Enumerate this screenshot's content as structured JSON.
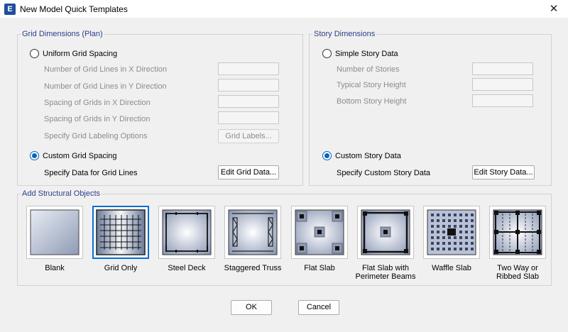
{
  "window": {
    "title": "New Model Quick Templates",
    "app_icon_letter": "E"
  },
  "grid": {
    "title": "Grid Dimensions (Plan)",
    "uniform_label": "Uniform Grid Spacing",
    "fields": [
      "Number of Grid Lines in X Direction",
      "Number of Grid Lines in Y Direction",
      "Spacing of Grids in X Direction",
      "Spacing of Grids in Y Direction"
    ],
    "labeling_label": "Specify Grid Labeling Options",
    "grid_labels_button": "Grid Labels...",
    "custom_label": "Custom Grid Spacing",
    "specify_label": "Specify Data for Grid Lines",
    "edit_button": "Edit Grid Data..."
  },
  "story": {
    "title": "Story Dimensions",
    "simple_label": "Simple Story Data",
    "fields": [
      "Number of Stories",
      "Typical Story Height",
      "Bottom Story Height"
    ],
    "custom_label": "Custom Story Data",
    "specify_label": "Specify Custom Story Data",
    "edit_button": "Edit Story Data..."
  },
  "objects": {
    "title": "Add Structural Objects",
    "selected": "Grid Only",
    "items": [
      {
        "label1": "Blank",
        "label2": ""
      },
      {
        "label1": "Grid Only",
        "label2": ""
      },
      {
        "label1": "Steel Deck",
        "label2": ""
      },
      {
        "label1": "Staggered Truss",
        "label2": ""
      },
      {
        "label1": "Flat Slab",
        "label2": ""
      },
      {
        "label1": "Flat Slab with",
        "label2": "Perimeter Beams"
      },
      {
        "label1": "Waffle Slab",
        "label2": ""
      },
      {
        "label1": "Two Way or",
        "label2": "Ribbed Slab"
      }
    ]
  },
  "footer": {
    "ok": "OK",
    "cancel": "Cancel"
  },
  "colors": {
    "accent": "#0067c0",
    "group_title": "#2c3e8c"
  }
}
